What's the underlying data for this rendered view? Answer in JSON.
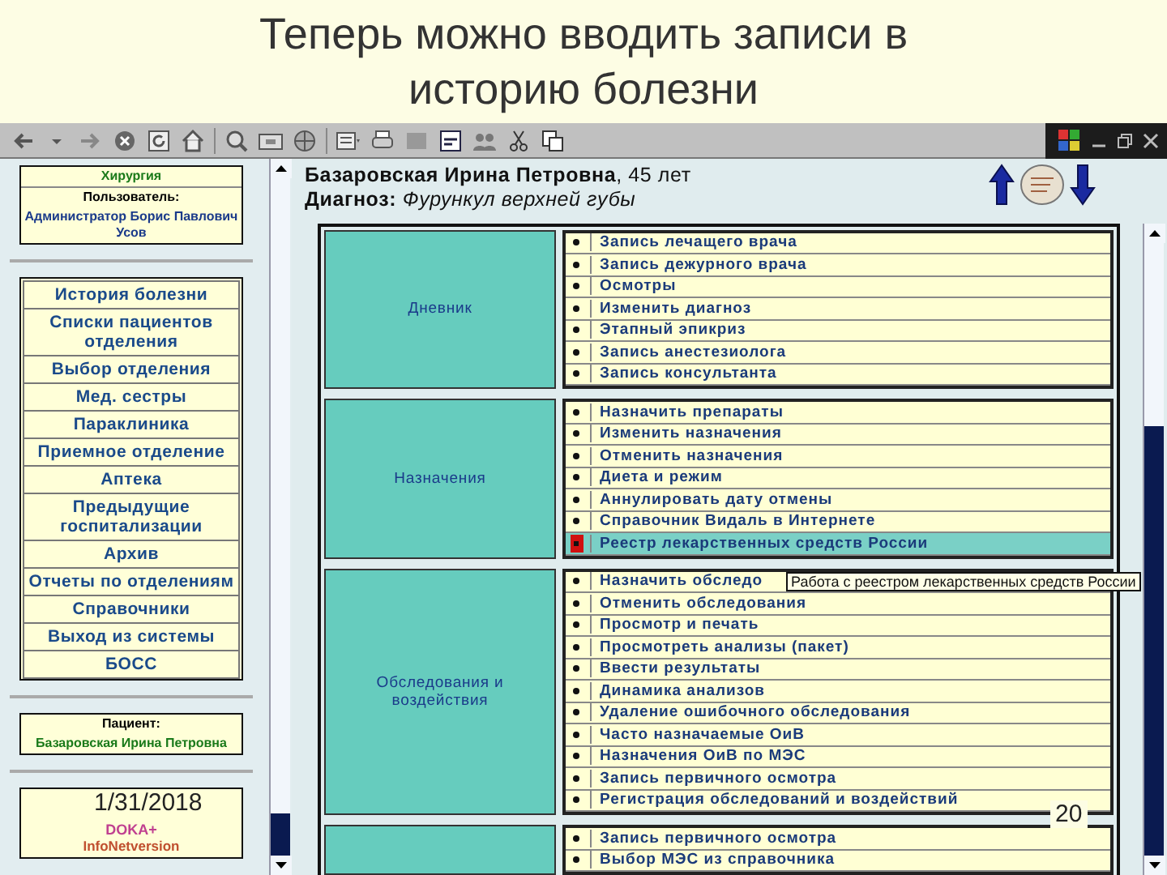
{
  "slide": {
    "title": "Теперь можно вводить записи в историю болезни",
    "date": "1/31/2018",
    "page_number": "20"
  },
  "sidebar": {
    "department": "Хирургия",
    "user_label": "Пользователь:",
    "user_name": "Администратор Борис Павлович Усов",
    "nav_items": [
      {
        "label": "История болезни"
      },
      {
        "label": "Списки пациентов отделения"
      },
      {
        "label": "Выбор отделения"
      },
      {
        "label": "Мед. сестры"
      },
      {
        "label": "Параклиника"
      },
      {
        "label": "Приемное отделение"
      },
      {
        "label": "Аптека"
      },
      {
        "label": "Предыдущие госпитализации"
      },
      {
        "label": "Архив"
      },
      {
        "label": "Отчеты по отделениям"
      },
      {
        "label": "Справочники"
      },
      {
        "label": "Выход из системы"
      },
      {
        "label": "БОСС"
      }
    ],
    "patient_label": "Пациент:",
    "patient_name": "Базаровская Ирина Петровна",
    "brand": "DOKA+",
    "version": "InfoNetversion"
  },
  "patient_header": {
    "name": "Базаровская Ирина Петровна",
    "age": ", 45 лет",
    "diagnosis_label": "Диагноз:",
    "diagnosis": "Фурункул верхней губы"
  },
  "groups": [
    {
      "label": "Дневник",
      "items": [
        {
          "label": "Запись лечащего врача",
          "selected": false
        },
        {
          "label": "Запись дежурного врача",
          "selected": false
        },
        {
          "label": "Осмотры",
          "selected": false
        },
        {
          "label": "Изменить диагноз",
          "selected": false
        },
        {
          "label": "Этапный эпикриз",
          "selected": false
        },
        {
          "label": "Запись анестезиолога",
          "selected": false
        },
        {
          "label": "Запись консультанта",
          "selected": false
        }
      ]
    },
    {
      "label": "Назначения",
      "items": [
        {
          "label": "Назначить препараты",
          "selected": false
        },
        {
          "label": "Изменить назначения",
          "selected": false
        },
        {
          "label": "Отменить назначения",
          "selected": false
        },
        {
          "label": "Диета и режим",
          "selected": false
        },
        {
          "label": "Аннулировать дату отмены",
          "selected": false
        },
        {
          "label": "Справочник Видаль в Интернете",
          "selected": false
        },
        {
          "label": "Реестр лекарственных средств России",
          "selected": true
        }
      ]
    },
    {
      "label": "Обследования и воздействия",
      "items": [
        {
          "label": "Назначить обследо",
          "selected": false
        },
        {
          "label": "Отменить обследования",
          "selected": false
        },
        {
          "label": "Просмотр и печать",
          "selected": false
        },
        {
          "label": "Просмотреть анализы (пакет)",
          "selected": false
        },
        {
          "label": "Ввести результаты",
          "selected": false
        },
        {
          "label": "Динамика анализов",
          "selected": false
        },
        {
          "label": "Удаление ошибочного обследования",
          "selected": false
        },
        {
          "label": "Часто назначаемые ОиВ",
          "selected": false
        },
        {
          "label": "Назначения ОиВ по МЭС",
          "selected": false
        },
        {
          "label": "Запись первичного осмотра",
          "selected": false
        },
        {
          "label": "Регистрация обследований и воздействий",
          "selected": false
        }
      ]
    },
    {
      "items": [
        {
          "label": "Запись первичного осмотра",
          "selected": false
        },
        {
          "label": "Выбор МЭС из справочника",
          "selected": false
        }
      ]
    }
  ],
  "tooltip": "Работа с реестром лекарственных средств России"
}
